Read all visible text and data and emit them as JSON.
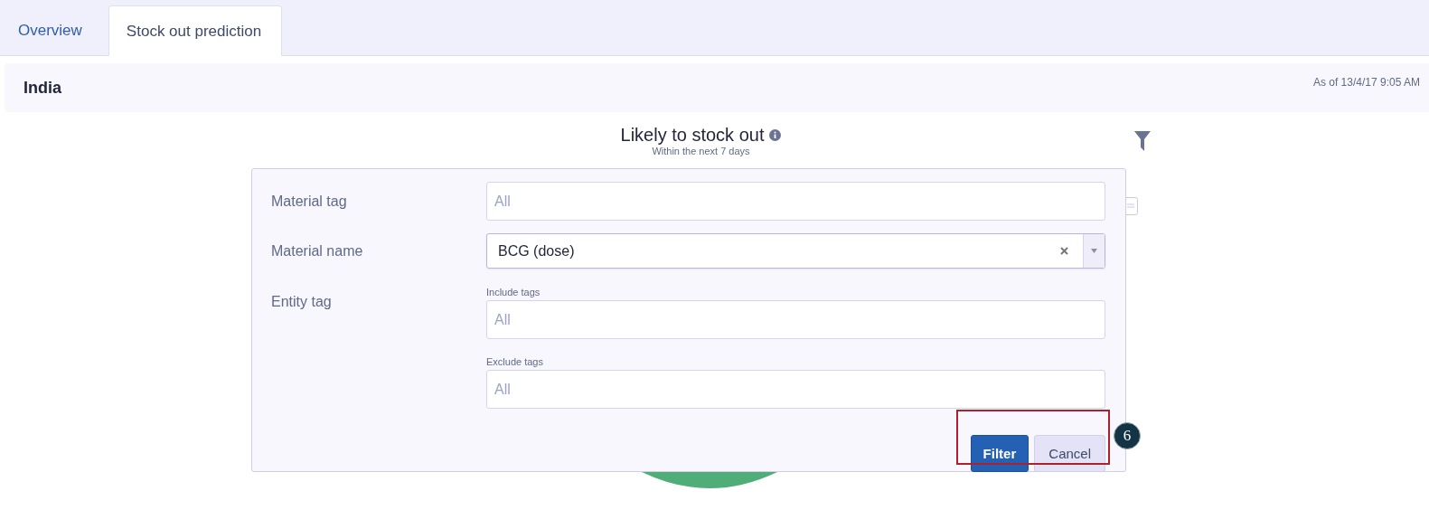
{
  "tabs": [
    {
      "label": "Overview",
      "selected": false
    },
    {
      "label": "Stock out prediction",
      "selected": true
    }
  ],
  "header": {
    "title": "India",
    "timestamp": "As of 13/4/17 9:05 AM"
  },
  "chart": {
    "title": "Likely to stock out",
    "subtitle": "Within the next 7 days"
  },
  "filter_popup": {
    "fields": [
      {
        "kind": "text",
        "label": "Material tag",
        "placeholder": "All"
      },
      {
        "kind": "select",
        "label": "Material name",
        "value": "BCG (dose)"
      },
      {
        "kind": "tags",
        "label": "Entity tag",
        "inputs": [
          {
            "caption": "Include tags",
            "placeholder": "All"
          },
          {
            "caption": "Exclude tags",
            "placeholder": "All"
          }
        ]
      }
    ],
    "buttons": [
      {
        "label": "Filter",
        "kind": "primary"
      },
      {
        "label": "Cancel",
        "kind": "secondary"
      }
    ]
  },
  "callout": {
    "badge": "6"
  }
}
